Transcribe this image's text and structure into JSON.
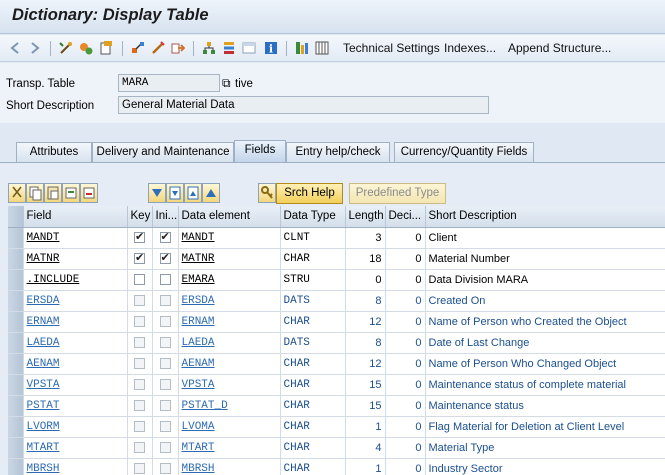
{
  "window": {
    "title": "Dictionary: Display Table"
  },
  "toolbar": {
    "technical_settings": "Technical Settings",
    "indexes": "Indexes...",
    "append_structure": "Append Structure..."
  },
  "header": {
    "transp_table_label": "Transp. Table",
    "transp_table_value": "MARA",
    "status_suffix": "tive",
    "short_desc_label": "Short Description",
    "short_desc_value": "General Material Data"
  },
  "tabs": [
    {
      "label": "Attributes"
    },
    {
      "label": "Delivery and Maintenance"
    },
    {
      "label": "Fields",
      "active": true
    },
    {
      "label": "Entry help/check"
    },
    {
      "label": "Currency/Quantity Fields"
    }
  ],
  "table_toolbar": {
    "srch_help": "Srch Help",
    "predefined_type": "Predefined Type"
  },
  "columns": {
    "field": "Field",
    "key": "Key",
    "initial": "Ini...",
    "data_element": "Data element",
    "data_type": "Data Type",
    "length": "Length",
    "decimals": "Deci...",
    "short_description": "Short Description"
  },
  "rows": [
    {
      "field": "MANDT",
      "key": true,
      "initial": true,
      "data_element": "MANDT",
      "data_type": "CLNT",
      "length": "3",
      "decimals": "0",
      "desc": "Client",
      "ro": false
    },
    {
      "field": "MATNR",
      "key": true,
      "initial": true,
      "data_element": "MATNR",
      "data_type": "CHAR",
      "length": "18",
      "decimals": "0",
      "desc": "Material Number",
      "ro": false
    },
    {
      "field": ".INCLUDE",
      "key": false,
      "initial": false,
      "data_element": "EMARA",
      "data_type": "STRU",
      "length": "0",
      "decimals": "0",
      "desc": "Data Division MARA",
      "ro": false
    },
    {
      "field": "ERSDA",
      "key": false,
      "initial": false,
      "data_element": "ERSDA",
      "data_type": "DATS",
      "length": "8",
      "decimals": "0",
      "desc": "Created On",
      "ro": true
    },
    {
      "field": "ERNAM",
      "key": false,
      "initial": false,
      "data_element": "ERNAM",
      "data_type": "CHAR",
      "length": "12",
      "decimals": "0",
      "desc": "Name of Person who Created the Object",
      "ro": true
    },
    {
      "field": "LAEDA",
      "key": false,
      "initial": false,
      "data_element": "LAEDA",
      "data_type": "DATS",
      "length": "8",
      "decimals": "0",
      "desc": "Date of Last Change",
      "ro": true
    },
    {
      "field": "AENAM",
      "key": false,
      "initial": false,
      "data_element": "AENAM",
      "data_type": "CHAR",
      "length": "12",
      "decimals": "0",
      "desc": "Name of Person Who Changed Object",
      "ro": true
    },
    {
      "field": "VPSTA",
      "key": false,
      "initial": false,
      "data_element": "VPSTA",
      "data_type": "CHAR",
      "length": "15",
      "decimals": "0",
      "desc": "Maintenance status of complete material",
      "ro": true
    },
    {
      "field": "PSTAT",
      "key": false,
      "initial": false,
      "data_element": "PSTAT_D",
      "data_type": "CHAR",
      "length": "15",
      "decimals": "0",
      "desc": "Maintenance status",
      "ro": true
    },
    {
      "field": "LVORM",
      "key": false,
      "initial": false,
      "data_element": "LVOMA",
      "data_type": "CHAR",
      "length": "1",
      "decimals": "0",
      "desc": "Flag Material for Deletion at Client Level",
      "ro": true
    },
    {
      "field": "MTART",
      "key": false,
      "initial": false,
      "data_element": "MTART",
      "data_type": "CHAR",
      "length": "4",
      "decimals": "0",
      "desc": "Material Type",
      "ro": true
    },
    {
      "field": "MBRSH",
      "key": false,
      "initial": false,
      "data_element": "MBRSH",
      "data_type": "CHAR",
      "length": "1",
      "decimals": "0",
      "desc": "Industry Sector",
      "ro": true
    }
  ]
}
